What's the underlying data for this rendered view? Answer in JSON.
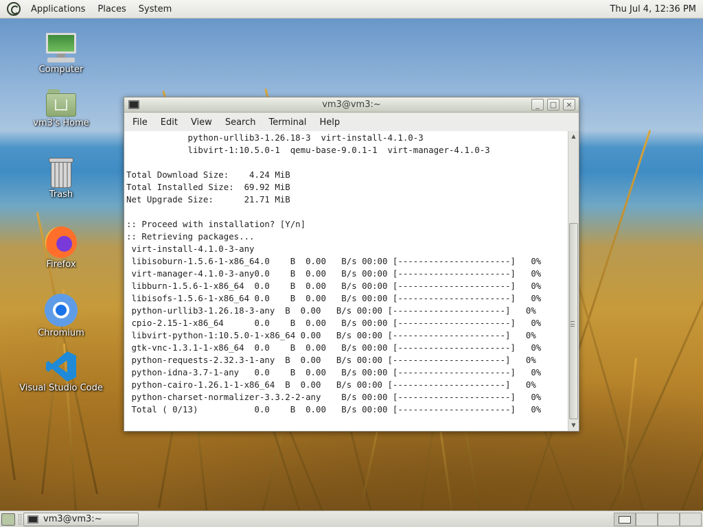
{
  "top_panel": {
    "menus": [
      "Applications",
      "Places",
      "System"
    ],
    "clock": "Thu Jul  4, 12:36 PM"
  },
  "desktop_icons": [
    {
      "label": "Computer",
      "icon": "computer-icon"
    },
    {
      "label": "vm3's Home",
      "icon": "home-folder-icon"
    },
    {
      "label": "Trash",
      "icon": "trash-icon"
    },
    {
      "label": "Firefox",
      "icon": "firefox-icon"
    },
    {
      "label": "Chromium",
      "icon": "chromium-icon"
    },
    {
      "label": "Visual Studio Code",
      "icon": "vscode-icon"
    }
  ],
  "window": {
    "title": "vm3@vm3:~",
    "buttons": {
      "minimize": "_",
      "maximize": "□",
      "close": "×"
    },
    "menus": [
      "File",
      "Edit",
      "View",
      "Search",
      "Terminal",
      "Help"
    ]
  },
  "terminal": {
    "lines": [
      "            python-urllib3-1.26.18-3  virt-install-4.1.0-3",
      "            libvirt-1:10.5.0-1  qemu-base-9.0.1-1  virt-manager-4.1.0-3",
      "",
      "Total Download Size:    4.24 MiB",
      "Total Installed Size:  69.92 MiB",
      "Net Upgrade Size:      21.71 MiB",
      "",
      ":: Proceed with installation? [Y/n]",
      ":: Retrieving packages...",
      " virt-install-4.1.0-3-any",
      " libisoburn-1.5.6-1-x86_64.0    B  0.00   B/s 00:00 [----------------------]   0%",
      " virt-manager-4.1.0-3-any0.0    B  0.00   B/s 00:00 [----------------------]   0%",
      " libburn-1.5.6-1-x86_64  0.0    B  0.00   B/s 00:00 [----------------------]   0%",
      " libisofs-1.5.6-1-x86_64 0.0    B  0.00   B/s 00:00 [----------------------]   0%",
      " python-urllib3-1.26.18-3-any  B  0.00   B/s 00:00 [----------------------]   0%",
      " cpio-2.15-1-x86_64      0.0    B  0.00   B/s 00:00 [----------------------]   0%",
      " libvirt-python-1:10.5.0-1-x86_64 0.00   B/s 00:00 [----------------------]   0%",
      " gtk-vnc-1.3.1-1-x86_64  0.0    B  0.00   B/s 00:00 [----------------------]   0%",
      " python-requests-2.32.3-1-any  B  0.00   B/s 00:00 [----------------------]   0%",
      " python-idna-3.7-1-any   0.0    B  0.00   B/s 00:00 [----------------------]   0%",
      " python-cairo-1.26.1-1-x86_64  B  0.00   B/s 00:00 [----------------------]   0%",
      " python-charset-normalizer-3.3.2-2-any    B/s 00:00 [----------------------]   0%",
      " Total ( 0/13)           0.0    B  0.00   B/s 00:00 [----------------------]   0%"
    ]
  },
  "bottom_panel": {
    "task_label": "vm3@vm3:~",
    "workspaces": 4,
    "active_workspace": 1
  }
}
